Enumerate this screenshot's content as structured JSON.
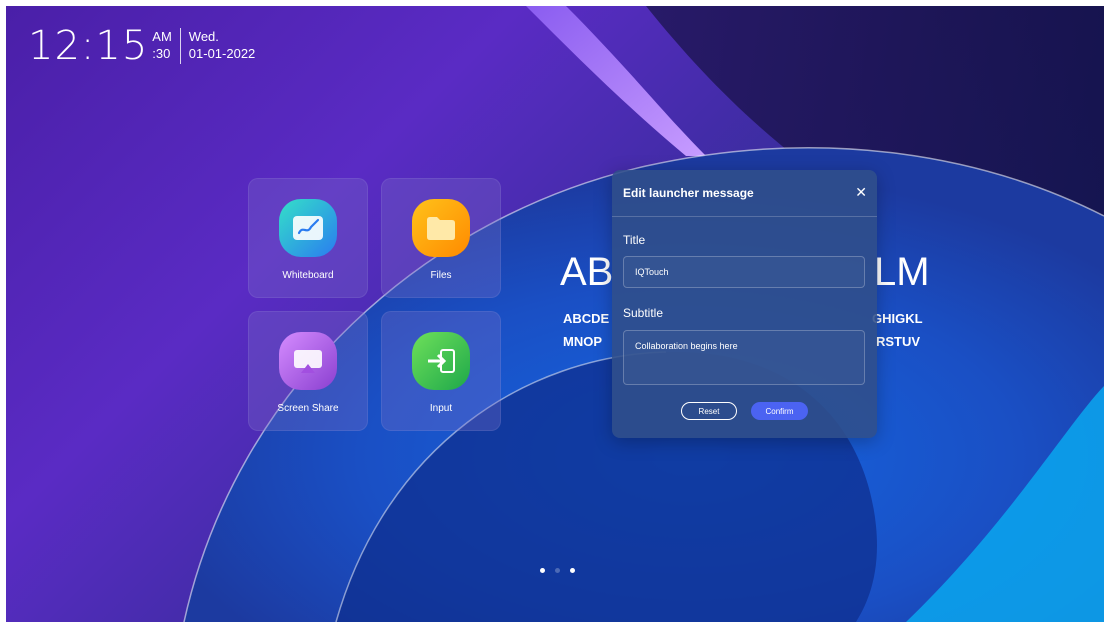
{
  "clock": {
    "time": "12:15",
    "ampm": "AM",
    "seconds": ":30",
    "weekday": "Wed.",
    "date": "01-01-2022"
  },
  "apps": [
    {
      "label": "Whiteboard",
      "icon": "whiteboard-icon"
    },
    {
      "label": "Files",
      "icon": "folder-icon"
    },
    {
      "label": "Screen Share",
      "icon": "screen-share-icon"
    },
    {
      "label": "Input",
      "icon": "input-icon"
    }
  ],
  "launcher_text": {
    "title_left": "AB",
    "title_right": "LM",
    "line1_left": "ABCDE",
    "line1_right": "GHIGKL",
    "line2_left": "MNOP",
    "line2_right": "RSTUV"
  },
  "dialog": {
    "title": "Edit launcher message",
    "close_icon": "close-icon",
    "title_label": "Title",
    "title_value": "IQTouch",
    "subtitle_label": "Subtitle",
    "subtitle_value": "Collaboration begins here",
    "reset_label": "Reset",
    "confirm_label": "Confirm"
  },
  "pager": {
    "pages": 3,
    "active_index": 1
  },
  "colors": {
    "accent": "#4b63f2",
    "background_top": "#4a1fa8",
    "background_bottom": "#1b6fd8"
  }
}
